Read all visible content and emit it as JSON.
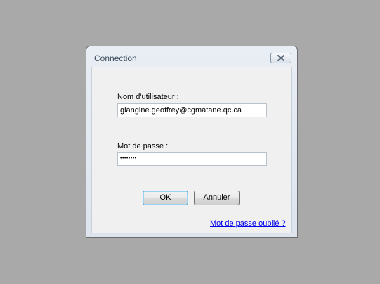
{
  "window": {
    "title": "Connection"
  },
  "form": {
    "username_label": "Nom d'utilisateur :",
    "username_value": "glangine.geoffrey@cgmatane.qc.ca",
    "password_label": "Mot de passe :",
    "password_value": "••••••••"
  },
  "buttons": {
    "ok_label": "OK",
    "cancel_label": "Annuler"
  },
  "links": {
    "forgot_password": "Mot de passe oublié ?"
  },
  "icons": {
    "close": "close-icon"
  },
  "colors": {
    "desktop_bg": "#a9a9a9",
    "link": "#0000ee",
    "default_button_border": "#3c7fb1"
  }
}
